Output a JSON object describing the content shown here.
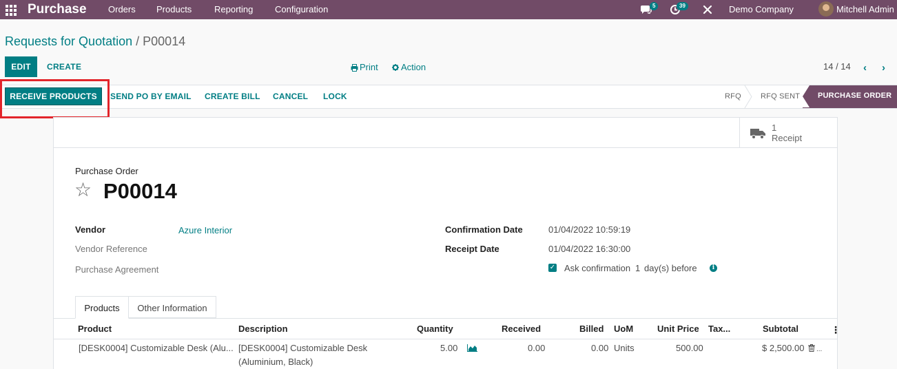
{
  "navbar": {
    "app_name": "Purchase",
    "menus": [
      "Orders",
      "Products",
      "Reporting",
      "Configuration"
    ],
    "messages_count": "5",
    "activities_count": "39",
    "company": "Demo Company",
    "user": "Mitchell Admin"
  },
  "breadcrumb": {
    "parent": "Requests for Quotation",
    "separator": "/",
    "current": "P00014"
  },
  "control_panel": {
    "edit_label": "EDIT",
    "create_label": "CREATE",
    "print_label": "Print",
    "action_label": "Action",
    "pager": "14 / 14"
  },
  "statusbar": {
    "buttons": [
      "RECEIVE PRODUCTS",
      "SEND PO BY EMAIL",
      "CREATE BILL",
      "CANCEL",
      "LOCK"
    ],
    "stages": [
      "RFQ",
      "RFQ SENT",
      "PURCHASE ORDER"
    ],
    "active_stage": "PURCHASE ORDER"
  },
  "smart_button": {
    "count": "1",
    "label": "Receipt"
  },
  "form": {
    "title_label": "Purchase Order",
    "name": "P00014",
    "left_fields": [
      {
        "label": "Vendor",
        "value": "Azure Interior"
      },
      {
        "label": "Vendor Reference",
        "value": ""
      },
      {
        "label": "Purchase Agreement",
        "value": ""
      }
    ],
    "right_fields": [
      {
        "label": "Confirmation Date",
        "value": "01/04/2022 10:59:19"
      },
      {
        "label": "Receipt Date",
        "value": "01/04/2022 16:30:00"
      }
    ],
    "ask_confirmation": {
      "checked": true,
      "prefix": "Ask confirmation",
      "days": "1",
      "suffix": "day(s) before"
    }
  },
  "tabs": [
    "Products",
    "Other Information"
  ],
  "table": {
    "columns": [
      "Product",
      "Description",
      "Quantity",
      "Received",
      "Billed",
      "UoM",
      "Unit Price",
      "Tax...",
      "Subtotal"
    ],
    "rows": [
      {
        "product": "[DESK0004] Customizable Desk (Alu...",
        "description_line1": "[DESK0004] Customizable Desk",
        "description_line2": "(Aluminium, Black)",
        "quantity": "5.00",
        "received": "0.00",
        "billed": "0.00",
        "uom": "Units",
        "unit_price": "500.00",
        "taxes": "",
        "subtotal": "$ 2,500.00"
      }
    ]
  },
  "colors": {
    "brand": "#714b67",
    "accent": "#017e84",
    "highlight": "#e2252b"
  }
}
